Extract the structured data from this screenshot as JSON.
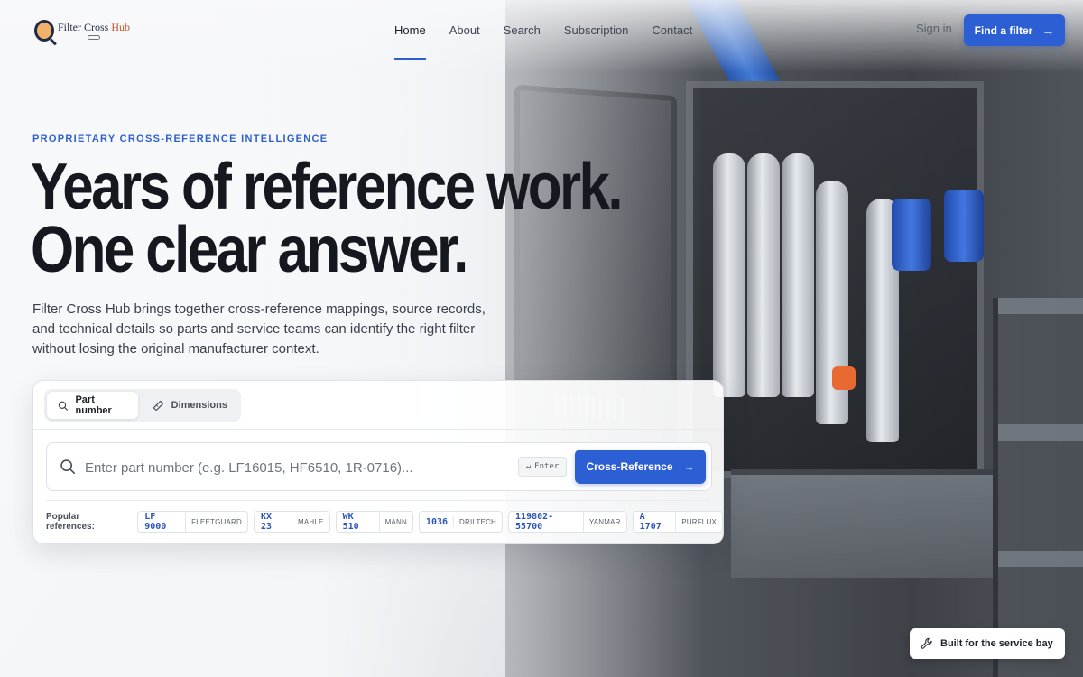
{
  "brand": {
    "name_part1": "Filter Cross ",
    "name_part2": "Hub",
    "logo_icon": "magnifier-logo-icon"
  },
  "nav": {
    "items": [
      {
        "label": "Home",
        "active": true
      },
      {
        "label": "About",
        "active": false
      },
      {
        "label": "Search",
        "active": false
      },
      {
        "label": "Subscription",
        "active": false
      },
      {
        "label": "Contact",
        "active": false
      }
    ],
    "sign_in": "Sign in",
    "cta_label": "Find a filter",
    "cta_icon": "arrow-right-icon"
  },
  "hero": {
    "eyebrow": "PROPRIETARY CROSS-REFERENCE INTELLIGENCE",
    "headline_line1": "Years of reference work.",
    "headline_line2": "One clear answer.",
    "lede": "Filter Cross Hub brings together cross-reference mappings, source records, and technical details so parts and service teams can identify the right filter without losing the original manufacturer context."
  },
  "search": {
    "tabs": [
      {
        "label": "Part number",
        "icon": "search-icon",
        "active": true
      },
      {
        "label": "Dimensions",
        "icon": "ruler-icon",
        "active": false
      }
    ],
    "placeholder": "Enter part number (e.g. LF16015, HF6510, 1R-0716)...",
    "value": "",
    "enter_hint": "Enter",
    "enter_glyph": "↵",
    "submit_label": "Cross-Reference",
    "popular_label": "Popular references:",
    "popular": [
      {
        "part": "LF 9000",
        "brand": "FLEETGUARD"
      },
      {
        "part": "KX 23",
        "brand": "MAHLE"
      },
      {
        "part": "WK 510",
        "brand": "MANN"
      },
      {
        "part": "1036",
        "brand": "DRILTECH"
      },
      {
        "part": "119802-55700",
        "brand": "YANMAR"
      },
      {
        "part": "A 1707",
        "brand": "PURFLUX"
      }
    ]
  },
  "badge": {
    "label": "Built for the service bay",
    "icon": "wrench-icon"
  },
  "colors": {
    "accent": "#2c5ed4",
    "eyebrow": "#2e5fcf",
    "headline": "#15181e"
  }
}
